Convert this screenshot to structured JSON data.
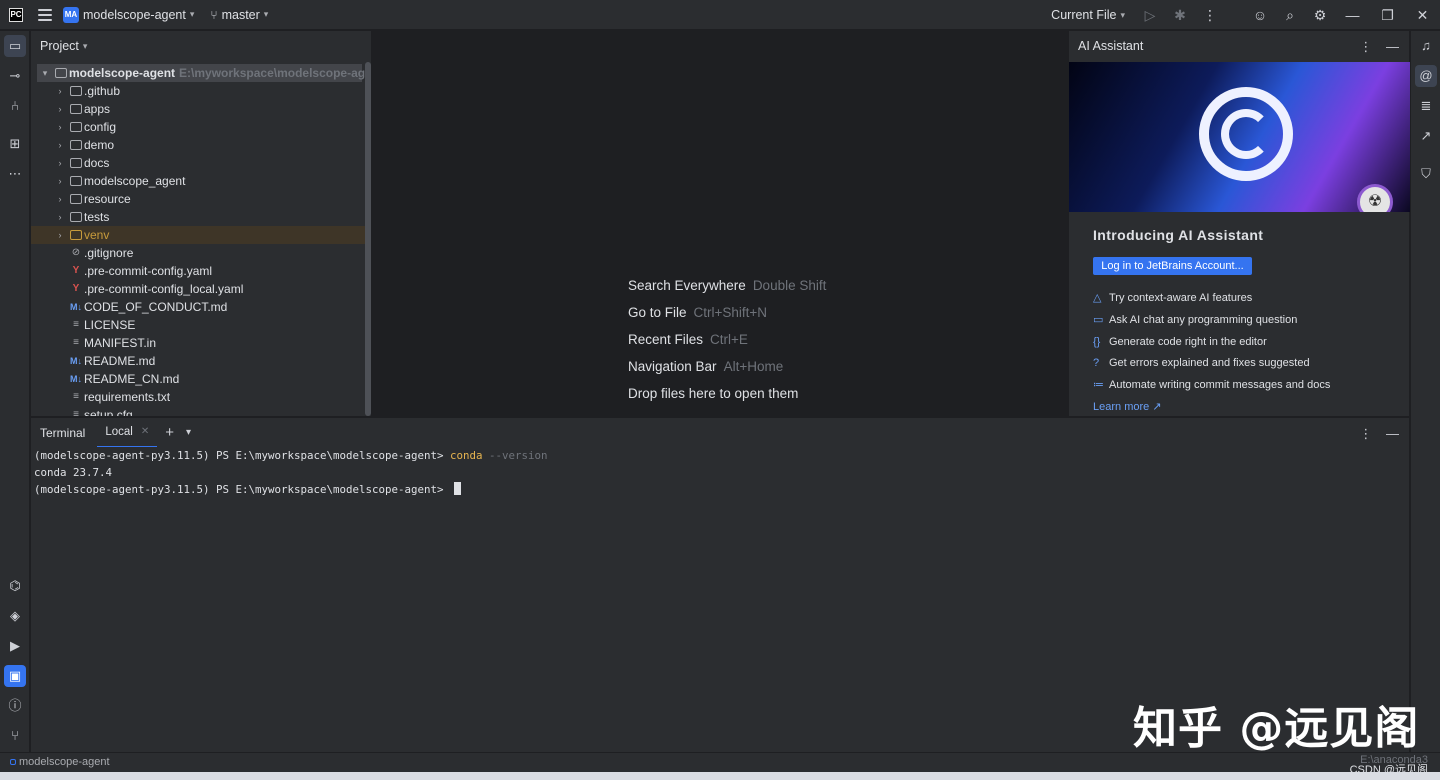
{
  "titlebar": {
    "logo": "PC",
    "project_badge": "MA",
    "project_name": "modelscope-agent",
    "branch": "master",
    "run_config": "Current File"
  },
  "project_panel": {
    "title": "Project",
    "root": {
      "name": "modelscope-agent",
      "path": "E:\\myworkspace\\modelscope-agent"
    },
    "folders": [
      ".github",
      "apps",
      "config",
      "demo",
      "docs",
      "modelscope_agent",
      "resource",
      "tests",
      "venv"
    ],
    "files": [
      {
        "name": ".gitignore",
        "icon": "ignore-icon"
      },
      {
        "name": ".pre-commit-config.yaml",
        "icon": "yaml-icon"
      },
      {
        "name": ".pre-commit-config_local.yaml",
        "icon": "yaml-icon"
      },
      {
        "name": "CODE_OF_CONDUCT.md",
        "icon": "markdown-icon"
      },
      {
        "name": "LICENSE",
        "icon": "text-icon"
      },
      {
        "name": "MANIFEST.in",
        "icon": "text-icon"
      },
      {
        "name": "README.md",
        "icon": "markdown-icon"
      },
      {
        "name": "README_CN.md",
        "icon": "markdown-icon"
      },
      {
        "name": "requirements.txt",
        "icon": "text-icon"
      },
      {
        "name": "setup.cfg",
        "icon": "text-icon"
      }
    ]
  },
  "welcome": {
    "items": [
      {
        "label": "Search Everywhere",
        "shortcut": "Double Shift"
      },
      {
        "label": "Go to File",
        "shortcut": "Ctrl+Shift+N"
      },
      {
        "label": "Recent Files",
        "shortcut": "Ctrl+E"
      },
      {
        "label": "Navigation Bar",
        "shortcut": "Alt+Home"
      },
      {
        "label": "Drop files here to open them",
        "shortcut": ""
      }
    ]
  },
  "ai_assistant": {
    "header": "AI Assistant",
    "title": "Introducing AI Assistant",
    "login_button": "Log in to JetBrains Account...",
    "features": [
      "Try context-aware AI features",
      "Ask AI chat any programming question",
      "Generate code right in the editor",
      "Get errors explained and fixes suggested",
      "Automate writing commit messages and docs"
    ],
    "learn_more": "Learn more ↗"
  },
  "terminal": {
    "title": "Terminal",
    "tab": "Local",
    "lines": [
      {
        "prompt": "(modelscope-agent-py3.11.5) PS E:\\myworkspace\\modelscope-agent> ",
        "cmd": "conda",
        "arg": " --version"
      },
      {
        "output": "conda 23.7.4"
      },
      {
        "prompt": "(modelscope-agent-py3.11.5) PS E:\\myworkspace\\modelscope-agent> "
      }
    ]
  },
  "watermark": "知乎 @远见阁",
  "status": {
    "project": "modelscope-agent",
    "interpreter": "E:\\anaconda3",
    "csdn": "CSDN @远见阁"
  },
  "colors": {
    "accent": "#3574f0",
    "panel_bg": "#2b2d30",
    "editor_bg": "#1e1f22",
    "venv_highlight": "#c79b3c",
    "terminal_command": "#e6b450"
  }
}
